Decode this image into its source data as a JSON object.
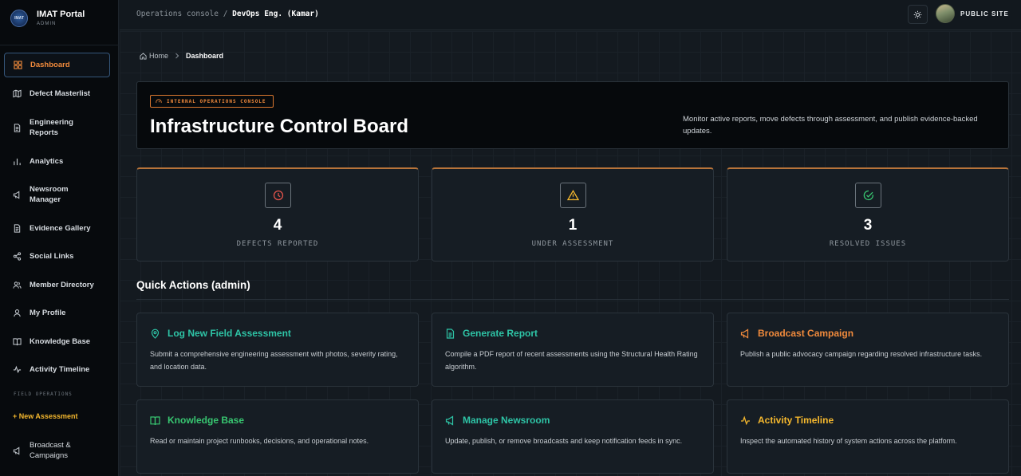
{
  "brand": {
    "title": "IMAT Portal",
    "subtitle": "ADMIN",
    "logo_text": "IMAT"
  },
  "sidebar": {
    "items": [
      {
        "label": "Dashboard",
        "icon": "grid-icon"
      },
      {
        "label": "Defect Masterlist",
        "icon": "map-icon"
      },
      {
        "label": "Engineering Reports",
        "icon": "document-icon"
      },
      {
        "label": "Analytics",
        "icon": "bar-chart-icon"
      },
      {
        "label": "Newsroom Manager",
        "icon": "megaphone-icon"
      },
      {
        "label": "Evidence Gallery",
        "icon": "document-icon"
      },
      {
        "label": "Social Links",
        "icon": "share-icon"
      },
      {
        "label": "Member Directory",
        "icon": "users-icon"
      },
      {
        "label": "My Profile",
        "icon": "user-icon"
      },
      {
        "label": "Knowledge Base",
        "icon": "book-icon"
      },
      {
        "label": "Activity Timeline",
        "icon": "activity-icon"
      }
    ],
    "section_label": "FIELD OPERATIONS",
    "new_assessment": "+ New Assessment",
    "broadcast": {
      "label": "Broadcast & Campaigns",
      "icon": "megaphone-icon"
    }
  },
  "topbar": {
    "context": "Operations console",
    "separator": "/",
    "user": "DevOps Eng. (Kamar)",
    "public_site": "PUBLIC SITE"
  },
  "breadcrumb": {
    "home": "Home",
    "current": "Dashboard"
  },
  "hero": {
    "badge": "INTERNAL OPERATIONS CONSOLE",
    "title": "Infrastructure Control Board",
    "description": "Monitor active reports, move defects through assessment, and publish evidence-backed updates."
  },
  "stats": [
    {
      "value": "4",
      "label": "DEFECTS REPORTED",
      "icon": "clock-icon",
      "color": "#e0524a"
    },
    {
      "value": "1",
      "label": "UNDER ASSESSMENT",
      "icon": "warning-icon",
      "color": "#f5b82e"
    },
    {
      "value": "3",
      "label": "RESOLVED ISSUES",
      "icon": "check-circle-icon",
      "color": "#38c771"
    }
  ],
  "quick_actions": {
    "title": "Quick Actions (admin)",
    "cards": [
      {
        "title": "Log New Field Assessment",
        "desc": "Submit a comprehensive engineering assessment with photos, severity rating, and location data.",
        "icon": "map-pin-icon",
        "color": "#2ec4a6"
      },
      {
        "title": "Generate Report",
        "desc": "Compile a PDF report of recent assessments using the Structural Health Rating algorithm.",
        "icon": "document-icon",
        "color": "#2ec4a6"
      },
      {
        "title": "Broadcast Campaign",
        "desc": "Publish a public advocacy campaign regarding resolved infrastructure tasks.",
        "icon": "megaphone-icon",
        "color": "#f08a3c"
      },
      {
        "title": "Knowledge Base",
        "desc": "Read or maintain project runbooks, decisions, and operational notes.",
        "icon": "book-icon",
        "color": "#38c771"
      },
      {
        "title": "Manage Newsroom",
        "desc": "Update, publish, or remove broadcasts and keep notification feeds in sync.",
        "icon": "megaphone-icon",
        "color": "#2ec4a6"
      },
      {
        "title": "Activity Timeline",
        "desc": "Inspect the automated history of system actions across the platform.",
        "icon": "activity-icon",
        "color": "#f5b82e"
      }
    ]
  },
  "colors": {
    "accent": "#f08a3c",
    "background": "#141a20",
    "sidebar": "#070a0d"
  }
}
